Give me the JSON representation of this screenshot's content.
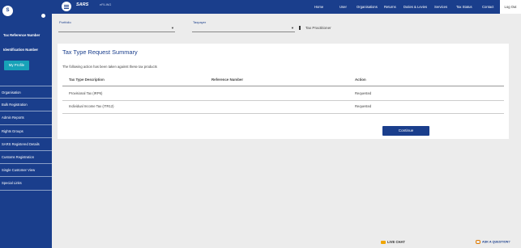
{
  "sidebar": {
    "avatar_initial": "S",
    "tax_reference_label": "Tax Reference Number",
    "identification_label": "Identification Number",
    "profile_button": "My Profile",
    "menu": [
      "Organisation",
      "Bulk Registration",
      "Admin Reports",
      "Rights Groups",
      "SARS Registered Details",
      "Customs Registration",
      "Single Customer View",
      "Special Links"
    ]
  },
  "topbar": {
    "logo": "SARS",
    "logo_sub": "eFILING",
    "nav": [
      "Home",
      "User",
      "Organisations",
      "Returns",
      "Duties & Levies",
      "Services",
      "Tax Status",
      "Contact"
    ],
    "logout": "Log Out"
  },
  "filters": {
    "portfolio_label": "Portfolio",
    "taxpayer_label": "Taxpayer",
    "tax_practitioner_label": "Tax Practitioner"
  },
  "summary": {
    "title": "Tax Type Request Summary",
    "subtitle": "The following action has been taken against these tax products",
    "columns": [
      "Tax Type Description",
      "Reference Number",
      "Action"
    ],
    "rows": [
      {
        "description": "Provisional Tax (IRP6)",
        "reference": "",
        "action": "Requested"
      },
      {
        "description": "Individual Income Tax (ITR12)",
        "reference": "",
        "action": "Requested"
      }
    ],
    "continue_button": "Continue"
  },
  "footer": {
    "live_chat": "LIVE CHAT",
    "ask_question": "ASK A QUESTION?"
  },
  "colors": {
    "primary": "#1a3e8c",
    "profile_button": "#17a2b8",
    "chat_accent": "#f0a500"
  }
}
